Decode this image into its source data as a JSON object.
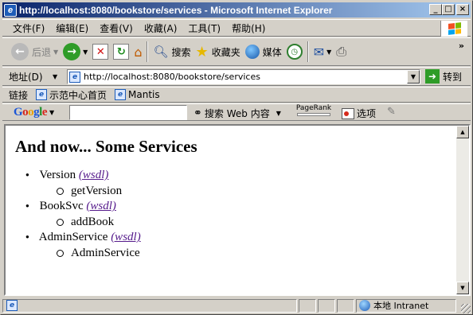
{
  "window": {
    "title": "http://localhost:8080/bookstore/services - Microsoft Internet Explorer"
  },
  "title_buttons": {
    "minimize": "_",
    "maximize": "□",
    "close": "×"
  },
  "menubar": {
    "items": [
      "文件(F)",
      "编辑(E)",
      "查看(V)",
      "收藏(A)",
      "工具(T)",
      "帮助(H)"
    ]
  },
  "toolbar": {
    "back_label": "后退",
    "search_label": "搜索",
    "favorites_label": "收藏夹",
    "media_label": "媒体",
    "chevron": "»",
    "icons": [
      "back-icon",
      "forward-icon",
      "stop-icon",
      "refresh-icon",
      "home-icon",
      "search-icon",
      "favorites-icon",
      "media-icon",
      "history-icon",
      "mail-icon",
      "print-icon"
    ]
  },
  "address": {
    "label": "地址(D)",
    "url": "http://localhost:8080/bookstore/services",
    "go_label": "转到"
  },
  "links": {
    "label": "链接",
    "items": [
      "示范中心首页",
      "Mantis"
    ]
  },
  "googlebar": {
    "logo": [
      "G",
      "o",
      "o",
      "g",
      "l",
      "e"
    ],
    "search_value": "",
    "search_web_label": "搜索 Web 内容",
    "pagerank_label": "PageRank",
    "options_label": "选项"
  },
  "content": {
    "heading": "And now... Some Services",
    "services": [
      {
        "name": "Version",
        "link": "(wsdl)",
        "operation": "getVersion"
      },
      {
        "name": "BookSvc",
        "link": "(wsdl)",
        "operation": "addBook"
      },
      {
        "name": "AdminService",
        "link": "(wsdl)",
        "operation": "AdminService"
      }
    ]
  },
  "statusbar": {
    "text": "",
    "zone": "本地 Intranet"
  },
  "colors": {
    "titlebar_start": "#0a246a",
    "titlebar_end": "#a6caf0",
    "chrome": "#d4d0c8",
    "visited_link": "#551a8b"
  }
}
